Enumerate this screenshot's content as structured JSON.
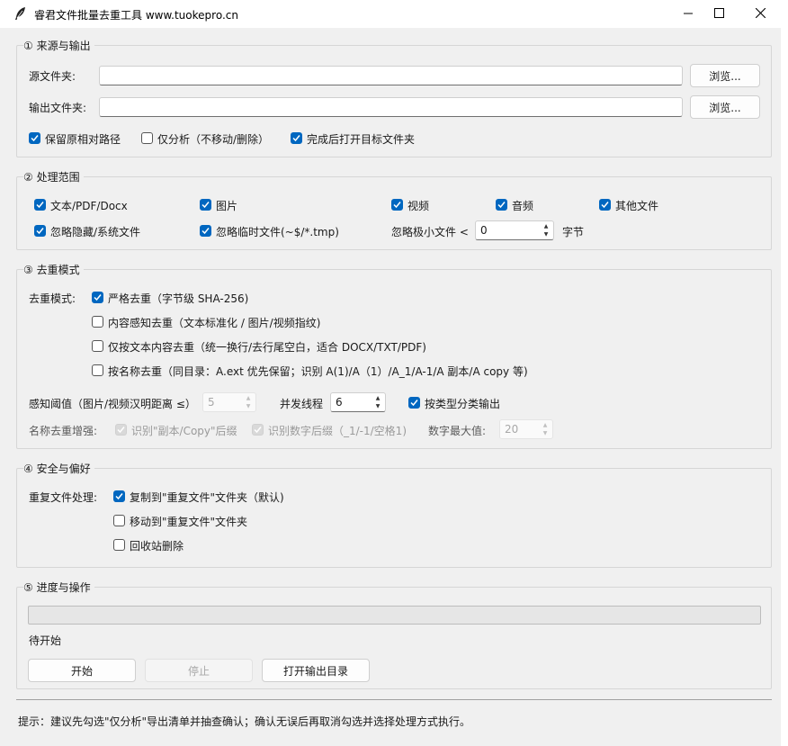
{
  "window": {
    "title": "睿君文件批量去重工具  www.tuokepro.cn",
    "icon": "feather-icon",
    "controls": [
      "minimize-icon",
      "maximize-icon",
      "close-icon"
    ]
  },
  "section1": {
    "legend": "① 来源与输出",
    "source_label": "源文件夹:",
    "source_value": "",
    "output_label": "输出文件夹:",
    "output_value": "",
    "browse1": "浏览...",
    "browse2": "浏览...",
    "keep_path": {
      "label": "保留原相对路径",
      "checked": true
    },
    "analyze_only": {
      "label": "仅分析（不移动/删除）",
      "checked": false
    },
    "open_after": {
      "label": "完成后打开目标文件夹",
      "checked": true
    }
  },
  "section2": {
    "legend": "② 处理范围",
    "types": [
      {
        "label": "文本/PDF/Docx",
        "checked": true
      },
      {
        "label": "图片",
        "checked": true
      },
      {
        "label": "视频",
        "checked": true
      },
      {
        "label": "音频",
        "checked": true
      },
      {
        "label": "其他文件",
        "checked": true
      }
    ],
    "ignore_hidden": {
      "label": "忽略隐藏/系统文件",
      "checked": true
    },
    "ignore_temp": {
      "label": "忽略临时文件(~$/*.tmp)",
      "checked": true
    },
    "min_size_label": "忽略极小文件 <",
    "min_size_value": "0",
    "min_size_unit": "字节"
  },
  "section3": {
    "legend": "③ 去重模式",
    "mode_label": "去重模式:",
    "modes": [
      {
        "label": "严格去重（字节级 SHA-256)",
        "checked": true
      },
      {
        "label": "内容感知去重（文本标准化 / 图片/视频指纹)",
        "checked": false
      },
      {
        "label": "仅按文本内容去重（统一换行/去行尾空白，适合 DOCX/TXT/PDF)",
        "checked": false
      },
      {
        "label": "按名称去重（同目录：A.ext 优先保留；识别 A(1)/A（1）/A_1/A-1/A 副本/A copy 等)",
        "checked": false
      }
    ],
    "threshold_label": "感知阈值（图片/视频汉明距离 ≤）",
    "threshold_value": "5",
    "threads_label": "并发线程",
    "threads_value": "6",
    "by_type": {
      "label": "按类型分类输出",
      "checked": true
    },
    "name_enh_label": "名称去重增强:",
    "copy_suffix": {
      "label": "识别\"副本/Copy\"后缀",
      "checked": true
    },
    "num_suffix": {
      "label": "识别数字后缀（_1/-1/空格1)",
      "checked": true
    },
    "max_num_label": "数字最大值:",
    "max_num_value": "20"
  },
  "section4": {
    "legend": "④ 安全与偏好",
    "dup_label": "重复文件处理:",
    "options": [
      {
        "label": "复制到\"重复文件\"文件夹（默认)",
        "checked": true
      },
      {
        "label": "移动到\"重复文件\"文件夹",
        "checked": false
      },
      {
        "label": "回收站删除",
        "checked": false
      }
    ]
  },
  "section5": {
    "legend": "⑤ 进度与操作",
    "progress": 0,
    "status": "待开始",
    "start": "开始",
    "stop": "停止",
    "open_output": "打开输出目录"
  },
  "footer": {
    "tip": "提示：建议先勾选\"仅分析\"导出清单并抽查确认；确认无误后再取消勾选并选择处理方式执行。"
  },
  "colors": {
    "accent": "#0067c0",
    "progress": "#06b025"
  }
}
